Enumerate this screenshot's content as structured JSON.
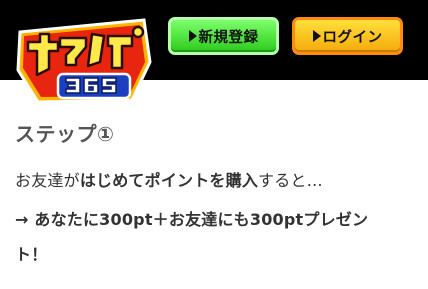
{
  "header": {
    "logo_alt": "ポケパ365",
    "register_label": "新規登録",
    "login_label": "ログイン"
  },
  "content": {
    "step_title": "ステップ①",
    "intro_prefix": "お友達が",
    "intro_bold": "はじめてポイントを購入",
    "intro_suffix": "すると…",
    "reward_line1": "→ あなたに300pt＋お友達にも300ptプレゼン",
    "reward_line2": "ト！"
  },
  "colors": {
    "header_bg": "#000000",
    "register_btn": "#3fd62e",
    "login_btn": "#ffc21a",
    "text": "#333333",
    "title": "#555555"
  }
}
